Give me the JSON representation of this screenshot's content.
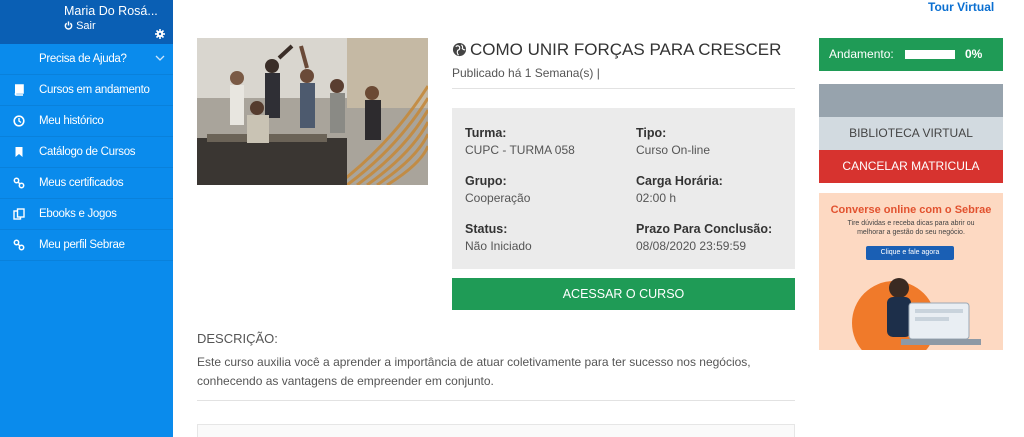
{
  "user": {
    "name": "Maria Do Rosá...",
    "logout": "Sair"
  },
  "sidebar": {
    "items": [
      {
        "label": "Precisa de Ajuda?",
        "icon": "chevron-down-icon"
      },
      {
        "label": "Cursos em andamento",
        "icon": "book-icon"
      },
      {
        "label": "Meu histórico",
        "icon": "clock-icon"
      },
      {
        "label": "Catálogo de Cursos",
        "icon": "bookmark-icon"
      },
      {
        "label": "Meus certificados",
        "icon": "link-icon"
      },
      {
        "label": "Ebooks e Jogos",
        "icon": "copy-icon"
      },
      {
        "label": "Meu perfil Sebrae",
        "icon": "link-icon"
      }
    ]
  },
  "header": {
    "tour": "Tour Virtual"
  },
  "course": {
    "title": "COMO UNIR FORÇAS PARA CRESCER",
    "published": "Publicado há 1 Semana(s)  |",
    "fields": {
      "turma_label": "Turma:",
      "turma_value": "CUPC - TURMA 058",
      "tipo_label": "Tipo:",
      "tipo_value": "Curso On-line",
      "grupo_label": "Grupo:",
      "grupo_value": "Cooperação",
      "carga_label": "Carga Horária:",
      "carga_value": "02:00 h",
      "status_label": "Status:",
      "status_value": "Não Iniciado",
      "prazo_label": "Prazo Para Conclusão:",
      "prazo_value": "08/08/2020 23:59:59"
    },
    "access_button": "ACESSAR O CURSO",
    "description_heading": "DESCRIÇÃO:",
    "description": "Este curso auxilia você a aprender a importância de atuar coletivamente para ter sucesso nos negócios, conhecendo as vantagens de empreender em conjunto."
  },
  "side_panel": {
    "progress_label": "Andamento:",
    "progress_value": "0%",
    "progress_fraction": 0,
    "library_button": "BIBLIOTECA VIRTUAL",
    "cancel_button": "CANCELAR MATRICULA"
  },
  "banner": {
    "title": "Converse online com o Sebrae",
    "subtitle": "Tire dúvidas e receba dicas para abrir ou melhorar a gestão do seu negócio.",
    "button": "Clique e fale agora"
  },
  "colors": {
    "sidebar": "#0a8bec",
    "sidebar_header": "#0a5fb4",
    "green": "#1f9b56",
    "red": "#d7332f",
    "info_bg": "#ebebeb"
  }
}
